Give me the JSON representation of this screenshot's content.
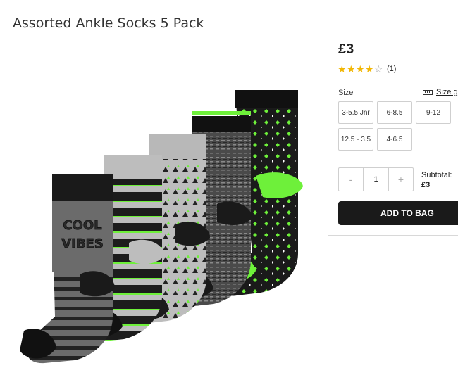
{
  "product": {
    "title": "Assorted Ankle Socks 5 Pack",
    "image_print": "COOL VIBES"
  },
  "panel": {
    "price": "£3",
    "rating": 4,
    "rating_max": 5,
    "review_count": "(1)",
    "size_label": "Size",
    "size_guide_label": "Size g",
    "sizes": [
      "3-5.5 Jnr",
      "6-8.5",
      "9-12",
      "12.5 - 3.5",
      "4-6.5"
    ],
    "quantity": "1",
    "qty_minus": "-",
    "qty_plus": "+",
    "subtotal_label": "Subtotal:",
    "subtotal_value": "£3",
    "add_to_bag_label": "ADD TO BAG"
  },
  "icons": {
    "star_filled": "star-icon",
    "star_empty": "star-outline-icon",
    "size_guide": "ruler-icon"
  },
  "colors": {
    "star": "#f2b705",
    "button_bg": "#1a1a1a",
    "sock_accent": "#6ef03a"
  }
}
